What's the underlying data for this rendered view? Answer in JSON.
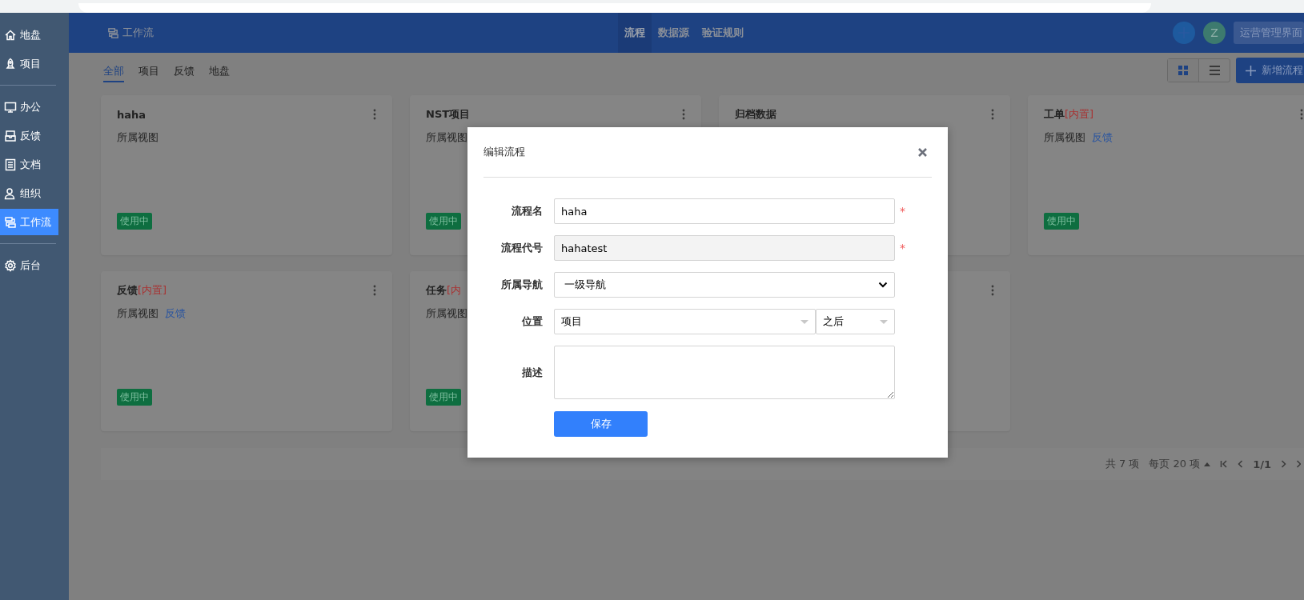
{
  "sidebar": {
    "groups": [
      {
        "items": [
          {
            "label": "地盘",
            "selected": false
          },
          {
            "label": "项目",
            "selected": false
          }
        ]
      },
      {
        "items": [
          {
            "label": "办公",
            "selected": false
          },
          {
            "label": "反馈",
            "selected": false
          },
          {
            "label": "文档",
            "selected": false
          },
          {
            "label": "组织",
            "selected": false
          },
          {
            "label": "工作流",
            "selected": true
          }
        ]
      },
      {
        "items": [
          {
            "label": "后台",
            "selected": false
          }
        ]
      }
    ]
  },
  "header": {
    "title": "工作流",
    "nav": [
      {
        "label": "流程",
        "selected": true
      },
      {
        "label": "数据源",
        "selected": false
      },
      {
        "label": "验证规则",
        "selected": false
      }
    ],
    "avatar": "Z",
    "admin_button": "运营管理界面"
  },
  "tabs": [
    {
      "label": "全部",
      "selected": true
    },
    {
      "label": "项目",
      "selected": false
    },
    {
      "label": "反馈",
      "selected": false
    },
    {
      "label": "地盘",
      "selected": false
    }
  ],
  "view_toggle": [
    {
      "selected": true
    },
    {
      "selected": false
    }
  ],
  "new_button": "新增流程",
  "cards": [
    {
      "kind": "card",
      "title": "haha",
      "view_label": "所属视图",
      "status": "使用中"
    },
    {
      "kind": "card",
      "title": "NST项目",
      "view_label": "所属视图",
      "status": "使用中"
    },
    {
      "kind": "card",
      "title": "归档数据"
    },
    {
      "kind": "card",
      "title": "工单",
      "badge": "[内置]",
      "view_label": "所属视图",
      "view": "反馈",
      "status": "使用中"
    },
    {
      "kind": "card",
      "title": "反馈",
      "badge": "[内置]",
      "view_label": "所属视图",
      "view": "反馈",
      "status": "使用中"
    },
    {
      "kind": "card",
      "title": "任务",
      "badge": "[内",
      "view_label": "所属视图",
      "status": "使用中"
    },
    {
      "kind": "card"
    }
  ],
  "pagination": {
    "total": "共 7 项",
    "page_size": "每页 20 项",
    "page": "1/1"
  },
  "dialog": {
    "title": "编辑流程",
    "fields": [
      {
        "kind": "text",
        "label": "流程名",
        "value": "haha",
        "required_mark": "*"
      },
      {
        "kind": "readonly",
        "label": "流程代号",
        "value": "hahatest",
        "required_mark": "*"
      },
      {
        "kind": "select",
        "label": "所属导航",
        "value": "一级导航"
      },
      {
        "kind": "combo",
        "label": "位置",
        "value": "项目",
        "value_2": "之后"
      },
      {
        "kind": "textarea",
        "label": "描述"
      }
    ],
    "save_button": "保存"
  }
}
